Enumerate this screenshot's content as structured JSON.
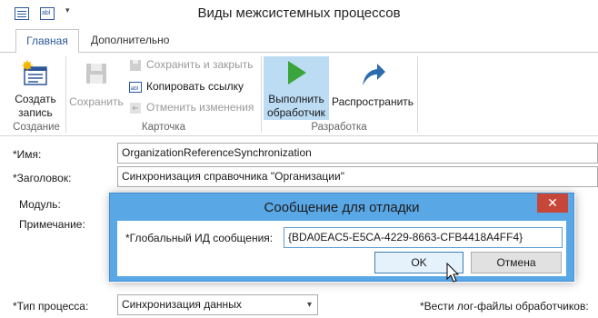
{
  "window": {
    "title": "Виды межсистемных процессов",
    "quick_access": {
      "icon_2_text": "abl",
      "icon_3_glyph": "▾"
    }
  },
  "tabs": [
    {
      "label": "Главная",
      "active": true
    },
    {
      "label": "Дополнительно",
      "active": false
    }
  ],
  "ribbon": {
    "create": {
      "label_line1": "Создать",
      "label_line2": "запись",
      "group": "Создание"
    },
    "save": {
      "label": "Сохранить"
    },
    "card": {
      "save_close": "Сохранить и закрыть",
      "copy_link": "Копировать ссылку",
      "cancel_changes": "Отменить изменения",
      "group": "Карточка"
    },
    "run": {
      "label_line1": "Выполнить",
      "label_line2": "обработчик",
      "group": "Разработка"
    },
    "spread": {
      "label": "Распространить"
    },
    "copy_link_icon_text": "abl"
  },
  "form": {
    "name_label": "*Имя:",
    "name_value": "OrganizationReferenceSynchronization",
    "header_label": "*Заголовок:",
    "header_value": "Синхронизация справочника \"Организации\"",
    "module_label": "Модуль:",
    "note_label": "Примечание:",
    "proctype_label": "*Тип процесса:",
    "proctype_value": "Синхронизация данных",
    "log_label": "*Вести лог-файлы обработчиков:"
  },
  "dialog": {
    "title": "Сообщение для отладки",
    "close_glyph": "✕",
    "field_label": "*Глобальный ИД сообщения:",
    "field_value": "{BDA0EAC5-E5CA-4229-8663-CFB4418A4FF4}",
    "ok_label": "OK",
    "cancel_label": "Отмена"
  },
  "colors": {
    "accent": "#2b579a",
    "dialog_frame": "#5aa7e6",
    "close_button": "#c7463a",
    "run_highlight": "#bcdcf4",
    "play_green": "#3aa53a",
    "arrow_blue": "#2b6cb0"
  }
}
